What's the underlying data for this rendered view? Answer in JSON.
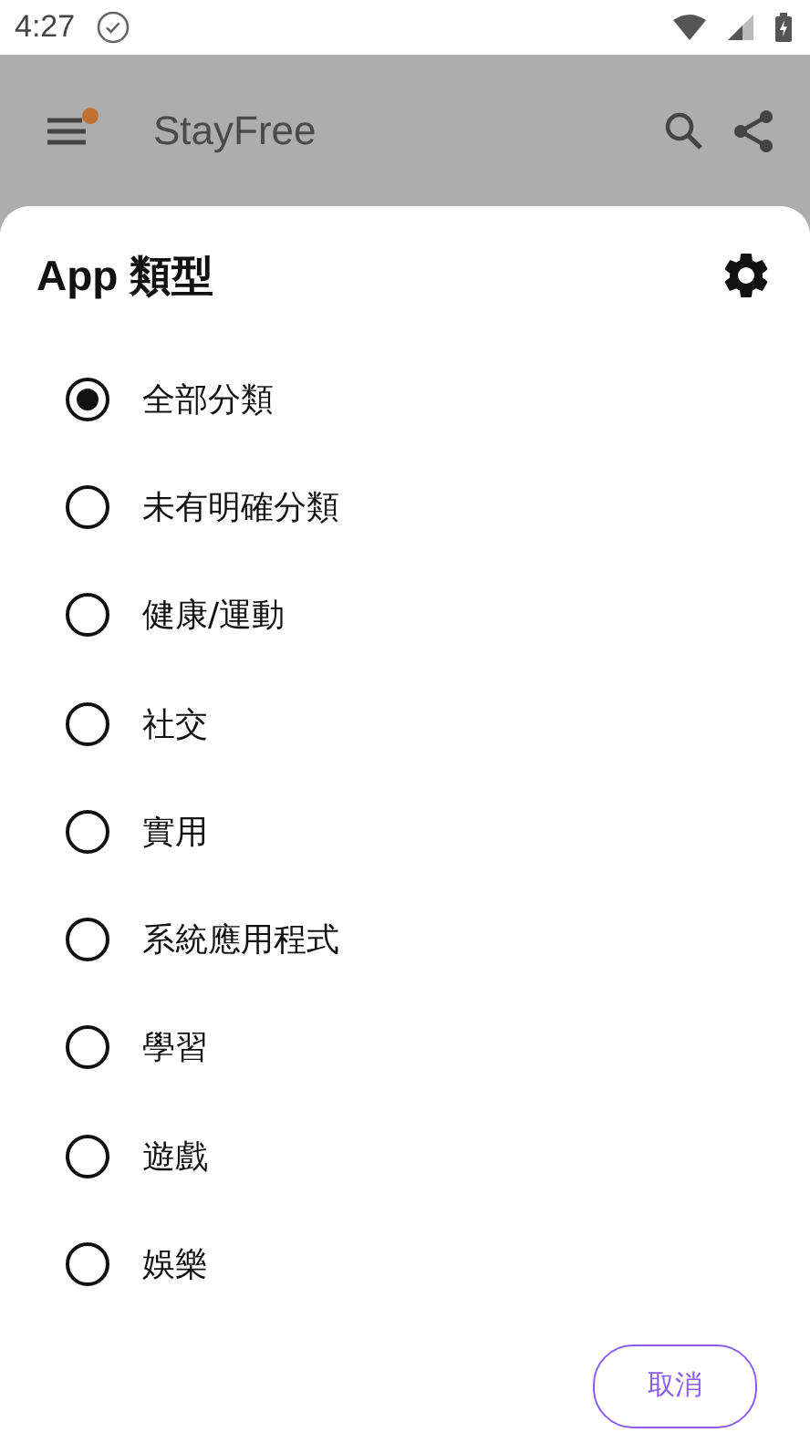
{
  "status_bar": {
    "time": "4:27"
  },
  "app_bar": {
    "title": "StayFree",
    "menu_badge": true
  },
  "dialog": {
    "title": "App 類型",
    "options": [
      {
        "label": "全部分類",
        "selected": true
      },
      {
        "label": "未有明確分類",
        "selected": false
      },
      {
        "label": "健康/運動",
        "selected": false
      },
      {
        "label": "社交",
        "selected": false
      },
      {
        "label": "實用",
        "selected": false
      },
      {
        "label": "系統應用程式",
        "selected": false
      },
      {
        "label": "學習",
        "selected": false
      },
      {
        "label": "遊戲",
        "selected": false
      },
      {
        "label": "娛樂",
        "selected": false
      }
    ],
    "buttons": [
      "取消"
    ]
  }
}
